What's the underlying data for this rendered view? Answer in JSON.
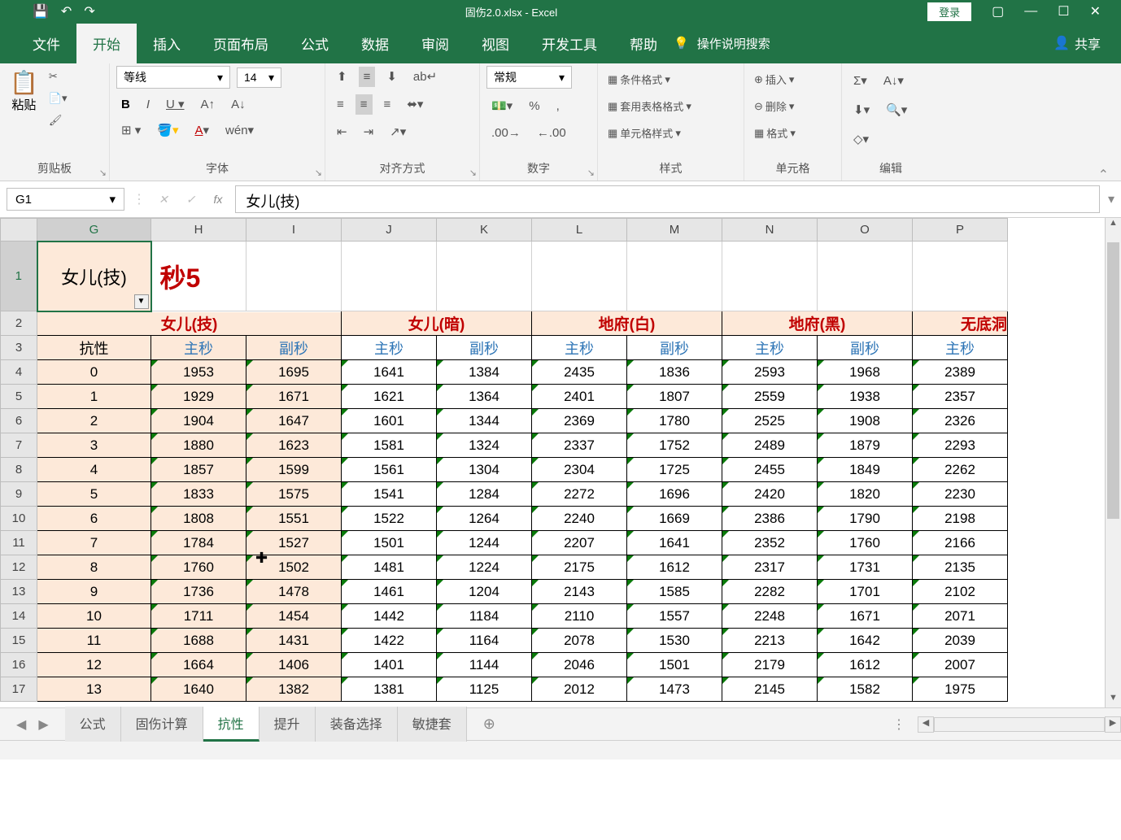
{
  "titleBar": {
    "filename": "固伤2.0.xlsx - Excel",
    "login": "登录"
  },
  "ribbonTabs": [
    "文件",
    "开始",
    "插入",
    "页面布局",
    "公式",
    "数据",
    "审阅",
    "视图",
    "开发工具",
    "帮助"
  ],
  "tellMe": "操作说明搜索",
  "share": "共享",
  "ribbon": {
    "clipboard": {
      "paste": "粘贴",
      "label": "剪贴板"
    },
    "font": {
      "name": "等线",
      "size": "14",
      "label": "字体"
    },
    "align": {
      "label": "对齐方式"
    },
    "number": {
      "format": "常规",
      "label": "数字"
    },
    "styles": {
      "cond": "条件格式",
      "table": "套用表格格式",
      "cell": "单元格样式",
      "label": "样式"
    },
    "cells": {
      "insert": "插入",
      "delete": "删除",
      "format": "格式",
      "label": "单元格"
    },
    "editing": {
      "label": "编辑"
    }
  },
  "nameBox": "G1",
  "formulaValue": "女儿(技)",
  "columns": [
    "G",
    "H",
    "I",
    "J",
    "K",
    "L",
    "M",
    "N",
    "O",
    "P"
  ],
  "row1": {
    "g": "女儿(技)",
    "h": "秒5"
  },
  "row2": [
    "女儿(技)",
    "女儿(暗)",
    "地府(白)",
    "地府(黑)",
    "无底洞"
  ],
  "row3": {
    "g": "抗性",
    "zhu": "主秒",
    "fu": "副秒"
  },
  "rows": [
    17,
    4,
    5,
    6,
    7,
    8,
    9,
    10,
    11,
    12,
    13,
    14,
    15,
    16,
    17
  ],
  "dataRow4": [
    "0",
    "1953",
    "1695",
    "1641",
    "1384",
    "2435",
    "1836",
    "2593",
    "1968",
    "2389"
  ],
  "dataRow5": [
    "1",
    "1929",
    "1671",
    "1621",
    "1364",
    "2401",
    "1807",
    "2559",
    "1938",
    "2357"
  ],
  "dataRow6": [
    "2",
    "1904",
    "1647",
    "1601",
    "1344",
    "2369",
    "1780",
    "2525",
    "1908",
    "2326"
  ],
  "dataRow7": [
    "3",
    "1880",
    "1623",
    "1581",
    "1324",
    "2337",
    "1752",
    "2489",
    "1879",
    "2293"
  ],
  "dataRow8": [
    "4",
    "1857",
    "1599",
    "1561",
    "1304",
    "2304",
    "1725",
    "2455",
    "1849",
    "2262"
  ],
  "dataRow9": [
    "5",
    "1833",
    "1575",
    "1541",
    "1284",
    "2272",
    "1696",
    "2420",
    "1820",
    "2230"
  ],
  "dataRow10": [
    "6",
    "1808",
    "1551",
    "1522",
    "1264",
    "2240",
    "1669",
    "2386",
    "1790",
    "2198"
  ],
  "dataRow11": [
    "7",
    "1784",
    "1527",
    "1501",
    "1244",
    "2207",
    "1641",
    "2352",
    "1760",
    "2166"
  ],
  "dataRow12": [
    "8",
    "1760",
    "1502",
    "1481",
    "1224",
    "2175",
    "1612",
    "2317",
    "1731",
    "2135"
  ],
  "dataRow13": [
    "9",
    "1736",
    "1478",
    "1461",
    "1204",
    "2143",
    "1585",
    "2282",
    "1701",
    "2102"
  ],
  "dataRow14": [
    "10",
    "1711",
    "1454",
    "1442",
    "1184",
    "2110",
    "1557",
    "2248",
    "1671",
    "2071"
  ],
  "dataRow15": [
    "11",
    "1688",
    "1431",
    "1422",
    "1164",
    "2078",
    "1530",
    "2213",
    "1642",
    "2039"
  ],
  "dataRow16": [
    "12",
    "1664",
    "1406",
    "1401",
    "1144",
    "2046",
    "1501",
    "2179",
    "1612",
    "2007"
  ],
  "dataRow17": [
    "13",
    "1640",
    "1382",
    "1381",
    "1125",
    "2012",
    "1473",
    "2145",
    "1582",
    "1975"
  ],
  "sheetTabs": [
    "公式",
    "固伤计算",
    "抗性",
    "提升",
    "装备选择",
    "敏捷套"
  ],
  "activeSheetIndex": 2,
  "chart_data": null
}
